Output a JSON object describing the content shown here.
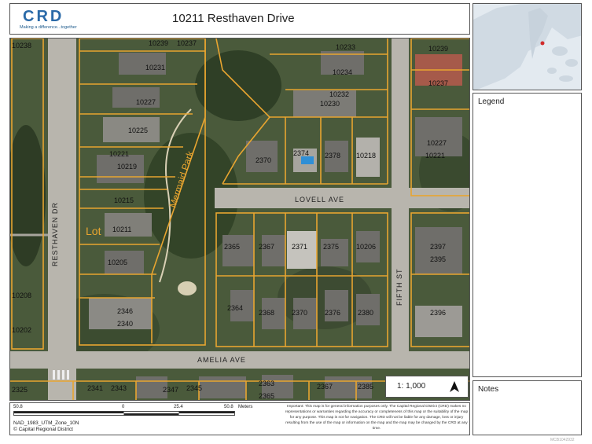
{
  "header": {
    "logo_text": "CRD",
    "tagline": "Making a difference...together",
    "title": "10211 Resthaven Drive"
  },
  "map": {
    "streets": {
      "resthaven": "RESTHAVEN DR",
      "lovell": "LOVELL AVE",
      "amelia": "AMELIA AVE",
      "fifth": "FIFTH ST"
    },
    "park_label": "Mermaid Park",
    "lot_label": "Lot",
    "parcels": [
      "10238",
      "10239",
      "10237",
      "10231",
      "10227",
      "10225",
      "10221",
      "10219",
      "10215",
      "10211",
      "10205",
      "10208",
      "10202",
      "2346",
      "2340",
      "2325",
      "2341",
      "2343",
      "2347",
      "2345",
      "2363",
      "2365",
      "2367",
      "2385",
      "10233",
      "10234",
      "10232",
      "10230",
      "2374",
      "2378",
      "10218",
      "2370",
      "2365",
      "2367",
      "2371",
      "2375",
      "10206",
      "2364",
      "2368",
      "2370",
      "2376",
      "2380",
      "10239",
      "10237",
      "10227",
      "10221",
      "2397",
      "2395",
      "2396"
    ],
    "scale": {
      "label": "1: 1,000",
      "north_icon": "north-arrow-icon"
    }
  },
  "footer": {
    "scale_ticks": [
      "50.8",
      "0",
      "25.4",
      "50.8",
      "Meters"
    ],
    "projection": "NAD_1983_UTM_Zone_10N",
    "copyright": "© Capital Regional District",
    "disclaimer": "Important: This map is for general information purposes only. The Capital Regional District (CRD) makes no representations or warranties regarding the accuracy or completeness of this map or the suitability of the map for any purpose. This map is not for navigation. The CRD will not be liable for any damage, loss or injury resulting from the use of the map or information on the map and the map may be changed by the CRD at any time."
  },
  "sidebar": {
    "legend_title": "Legend",
    "notes_title": "Notes"
  },
  "watermark": "MCB1042932",
  "colors": {
    "parcel_line": "#e8a530",
    "road": "#b9b6ae",
    "vegetation": "#3f5233",
    "water": "#2f8fd6",
    "land": "#dfe6ec",
    "brand_blue": "#2b6aa8"
  }
}
